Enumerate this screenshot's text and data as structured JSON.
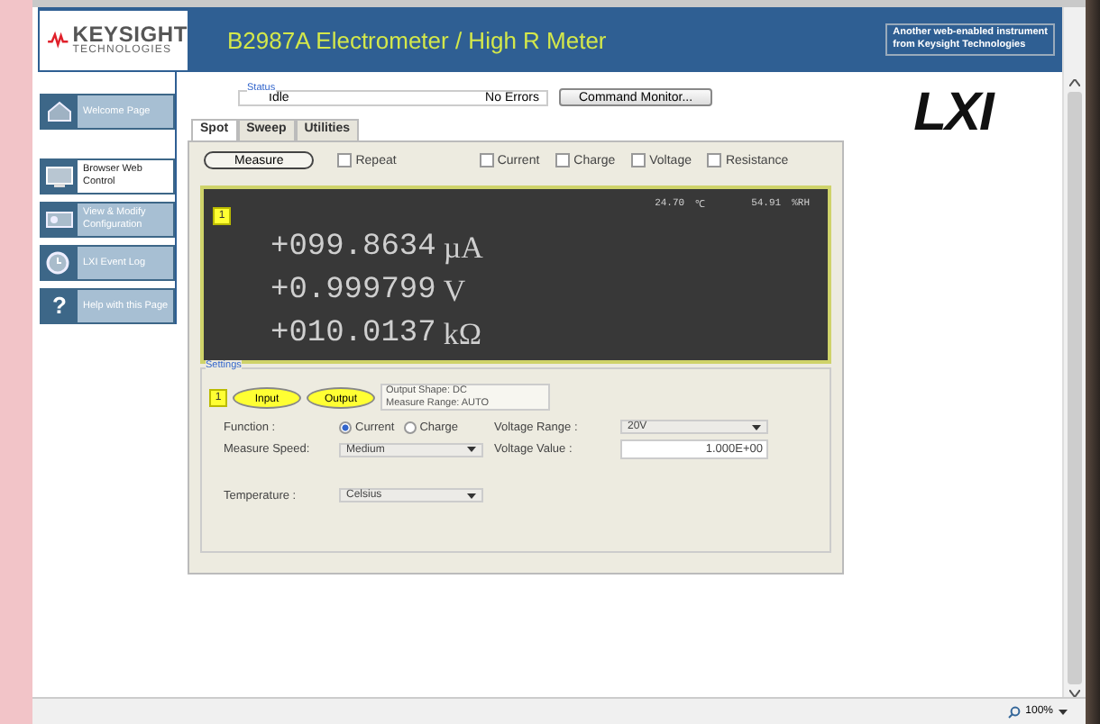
{
  "header": {
    "brand": "KEYSIGHT",
    "brand_sub": "TECHNOLOGIES",
    "title": "B2987A Electrometer / High R Meter",
    "tagline": [
      "Another web-enabled instrument",
      "from Keysight Technologies"
    ]
  },
  "nav": [
    {
      "label": "Welcome Page",
      "kind": "home",
      "selected": false
    },
    {
      "label": "Browser Web Control",
      "kind": "monitor",
      "selected": true
    },
    {
      "label": "View & Modify Configuration",
      "kind": "config",
      "selected": false
    },
    {
      "label": "LXI Event Log",
      "kind": "log",
      "selected": false
    },
    {
      "label": "Help with this Page",
      "kind": "help",
      "glyph": "?",
      "selected": false
    }
  ],
  "status": {
    "label": "Status",
    "state": "Idle",
    "errors": "No Errors",
    "button": "Command Monitor..."
  },
  "tabs": [
    {
      "label": "Spot",
      "selected": true
    },
    {
      "label": "Sweep",
      "selected": false
    },
    {
      "label": "Utilities",
      "selected": false
    }
  ],
  "toolbar": {
    "measure": "Measure",
    "repeat": {
      "label": "Repeat",
      "checked": false
    },
    "checks": [
      {
        "label": "Current",
        "checked": false
      },
      {
        "label": "Charge",
        "checked": false
      },
      {
        "label": "Voltage",
        "checked": false
      },
      {
        "label": "Resistance",
        "checked": false
      }
    ]
  },
  "display": {
    "channel": "1",
    "temperature": "24.70",
    "temp_unit": "℃",
    "humidity": "54.91",
    "humidity_unit": "%RH",
    "readings": [
      {
        "value": "+099.8634",
        "unit": "µA"
      },
      {
        "value": "+0.999799",
        "unit": "V"
      },
      {
        "value": "+010.0137",
        "unit": "kΩ"
      }
    ]
  },
  "settings": {
    "legend": "Settings",
    "channel": "1",
    "buttons": [
      "Input",
      "Output"
    ],
    "info": [
      "Output Shape: DC",
      "Measure Range: AUTO"
    ],
    "function_label": "Function :",
    "function_options": [
      {
        "label": "Current",
        "selected": true
      },
      {
        "label": "Charge",
        "selected": false
      }
    ],
    "speed_label": "Measure Speed:",
    "speed": "Medium",
    "vrange_label": "Voltage Range :",
    "vrange": "20V",
    "vvalue_label": "Voltage Value :",
    "vvalue": "1.000E+00",
    "temp_label": "Temperature :",
    "temp": "Celsius"
  },
  "logo": "LXI",
  "zoom": "100%"
}
